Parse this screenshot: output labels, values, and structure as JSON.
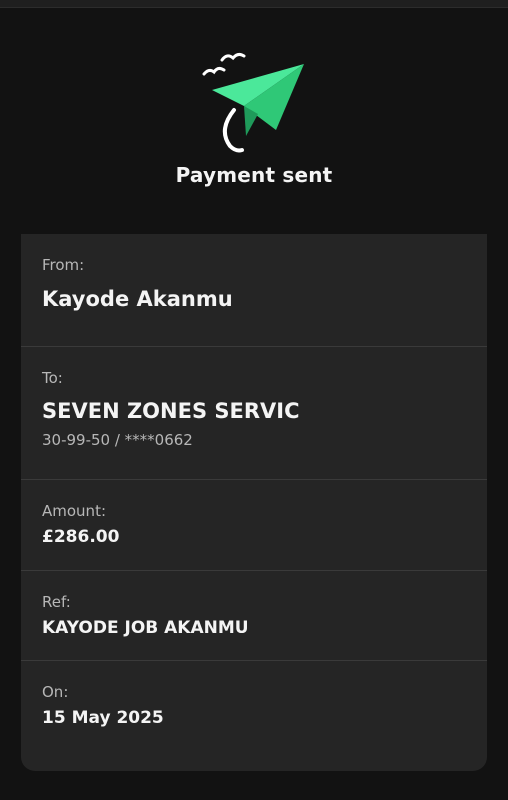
{
  "hero": {
    "icon": "paper-plane-icon",
    "title": "Payment sent"
  },
  "details": {
    "from": {
      "label": "From:",
      "value": "Kayode Akanmu"
    },
    "to": {
      "label": "To:",
      "value": "SEVEN ZONES SERVIC",
      "account": "30-99-50 / ****0662"
    },
    "amount": {
      "label": "Amount:",
      "value": "£286.00"
    },
    "ref": {
      "label": "Ref:",
      "value": "KAYODE JOB AKANMU"
    },
    "on": {
      "label": "On:",
      "value": "15 May 2025"
    }
  },
  "colors": {
    "background": "#121212",
    "card": "#252525",
    "accent_green": "#3ddc84"
  }
}
